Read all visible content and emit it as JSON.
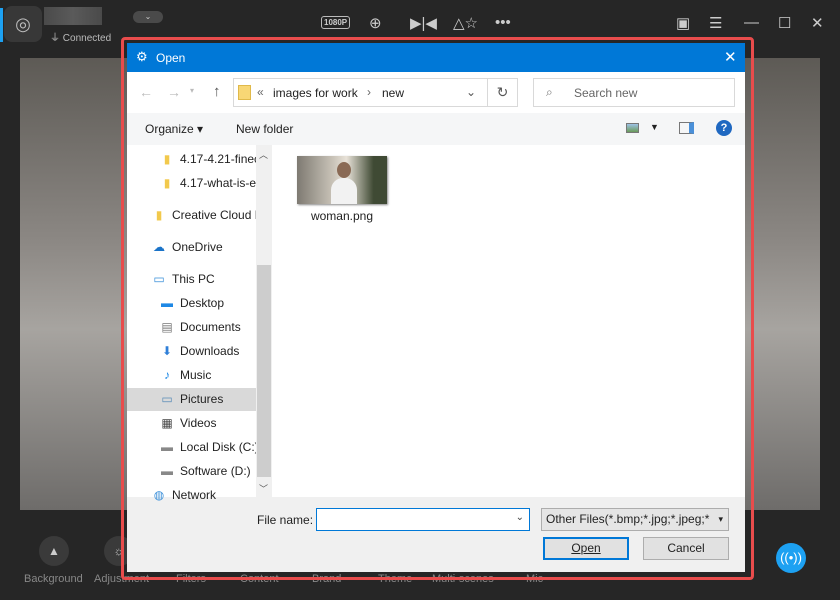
{
  "app": {
    "status": "Connected",
    "resolution_badge": "1080P",
    "toolbar_icons": [
      "zoom-in-icon",
      "mirror-icon",
      "shapes-icon",
      "more-icon"
    ],
    "window_icons": [
      "play-icon",
      "menu-icon",
      "minimize-icon",
      "maximize-icon",
      "close-icon"
    ],
    "bottom_items": [
      {
        "label": "Background",
        "icon": "image-icon"
      },
      {
        "label": "Adjustment",
        "icon": "sun-icon"
      },
      {
        "label": "Filters"
      },
      {
        "label": "Content"
      },
      {
        "label": "Brand"
      },
      {
        "label": "Theme"
      },
      {
        "label": "Multi-scenes"
      },
      {
        "label": "Mic"
      }
    ],
    "accent_color": "#1da1f2"
  },
  "dialog": {
    "title": "Open",
    "breadcrumb": {
      "overflow": "«",
      "items": [
        "images for work",
        "new"
      ]
    },
    "search_placeholder": "Search new",
    "toolbar": {
      "organize": "Organize",
      "new_folder": "New folder"
    },
    "nav_items": [
      {
        "label": "4.17-4.21-finec",
        "icon": "folder-icon",
        "indent": 2
      },
      {
        "label": "4.17-what-is-e",
        "icon": "folder-icon",
        "indent": 2
      },
      {
        "label": "Creative Cloud F",
        "icon": "creative-cloud-folder-icon",
        "indent": 1
      },
      {
        "label": "OneDrive",
        "icon": "onedrive-icon",
        "indent": 1
      },
      {
        "label": "This PC",
        "icon": "computer-icon",
        "indent": 1
      },
      {
        "label": "Desktop",
        "icon": "desktop-icon",
        "indent": 2
      },
      {
        "label": "Documents",
        "icon": "documents-icon",
        "indent": 2
      },
      {
        "label": "Downloads",
        "icon": "downloads-icon",
        "indent": 2
      },
      {
        "label": "Music",
        "icon": "music-icon",
        "indent": 2
      },
      {
        "label": "Pictures",
        "icon": "pictures-icon",
        "indent": 2,
        "selected": true
      },
      {
        "label": "Videos",
        "icon": "videos-icon",
        "indent": 2
      },
      {
        "label": "Local Disk (C:)",
        "icon": "drive-icon",
        "indent": 2
      },
      {
        "label": "Software (D:)",
        "icon": "drive-icon",
        "indent": 2
      },
      {
        "label": "Network",
        "icon": "network-icon",
        "indent": 1
      }
    ],
    "files": [
      {
        "name": "woman.png"
      }
    ],
    "file_name_label": "File name:",
    "file_name_value": "",
    "file_type": "Other Files(*.bmp;*.jpg;*.jpeg;*",
    "open_label": "Open",
    "cancel_label": "Cancel",
    "title_color": "#0078d7"
  }
}
